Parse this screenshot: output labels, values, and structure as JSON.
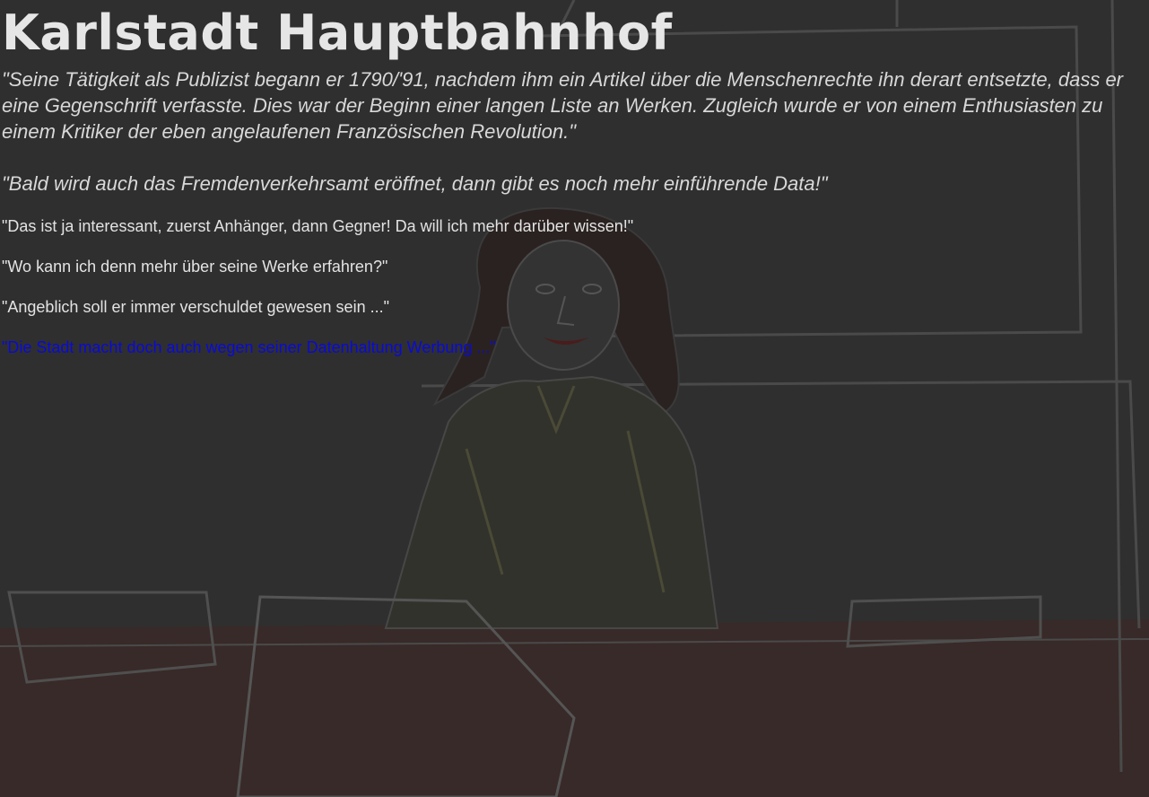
{
  "scene": {
    "title": "Karlstadt Hauptbahnhof",
    "background_image": "pencil-drawing-woman-at-desk",
    "colors": {
      "background": "#2f2f2f",
      "text": "#e3e3e3",
      "active_choice": "#0a0ad8"
    }
  },
  "narration": [
    "\"Seine Tätigkeit als Publizist begann er 1790/'91, nachdem ihm ein Artikel über die Menschenrechte ihn derart entsetzte, dass er eine Gegenschrift verfasste. Dies war der Beginn einer langen Liste an Werken. Zugleich wurde er von einem Enthusiasten zu einem Kritiker der eben angelaufenen Französischen Revolution.\"",
    "\"Bald wird auch das Fremdenverkehrsamt eröffnet, dann gibt es noch mehr einführende Data!\""
  ],
  "choices": [
    "\"Das ist ja interessant, zuerst Anhänger, dann Gegner! Da will ich mehr darüber wissen!\"",
    "\"Wo kann ich denn mehr über seine Werke erfahren?\"",
    "\"Angeblich soll er immer verschuldet gewesen sein ...\"",
    "\"Die Stadt macht doch auch wegen seiner Datenhaltung Werbung ...\""
  ]
}
